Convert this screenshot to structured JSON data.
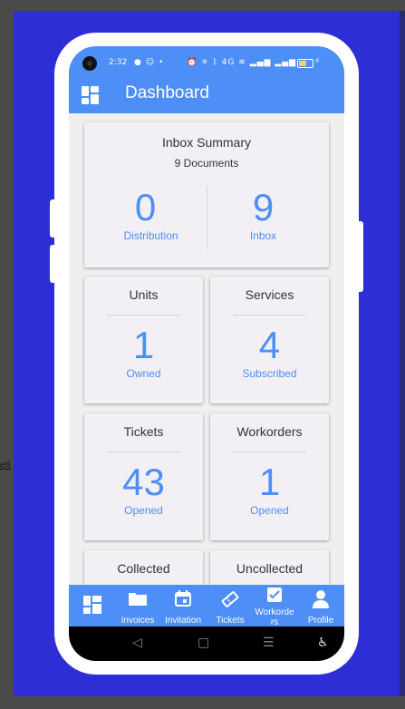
{
  "status_bar": {
    "time": "2:32",
    "left_icons": "● ☺ •",
    "right_icons": "⏰ ✳ ᛒ 4G ≋ ▂▄▆ ▂▄▆",
    "battery_level": 0.55,
    "charging_icon": "⚡"
  },
  "app": {
    "title": "Dashboard",
    "menu_icon": "dashboard-grid-icon"
  },
  "inbox_summary": {
    "title": "Inbox Summary",
    "subtitle": "9 Documents",
    "distribution": {
      "value": "0",
      "label": "Distribution"
    },
    "inbox": {
      "value": "9",
      "label": "Inbox"
    }
  },
  "cards": {
    "units": {
      "title": "Units",
      "value": "1",
      "label": "Owned"
    },
    "services": {
      "title": "Services",
      "value": "4",
      "label": "Subscribed"
    },
    "tickets": {
      "title": "Tickets",
      "value": "43",
      "label": "Opened"
    },
    "workorders": {
      "title": "Workorders",
      "value": "1",
      "label": "Opened"
    },
    "collected": {
      "title": "Collected"
    },
    "uncollected": {
      "title": "Uncollected"
    }
  },
  "bottom_nav": [
    {
      "label": "",
      "icon": "dashboard-icon"
    },
    {
      "label": "Invoices",
      "icon": "folder-icon"
    },
    {
      "label": "Invitation",
      "icon": "calendar-icon"
    },
    {
      "label": "Tickets",
      "icon": "ticket-icon"
    },
    {
      "label": "Workorders",
      "icon": "checkbox-icon"
    },
    {
      "label": "Profile",
      "icon": "person-icon"
    }
  ],
  "system_nav": {
    "back": "◁",
    "home": "▢",
    "recents": "☰",
    "accessibility": "♿"
  },
  "background_text": {
    "left": "ell",
    "right": ""
  },
  "colors": {
    "accent": "#4d8ef7",
    "background": "#2e2ed6",
    "card": "#f3f0f5"
  }
}
